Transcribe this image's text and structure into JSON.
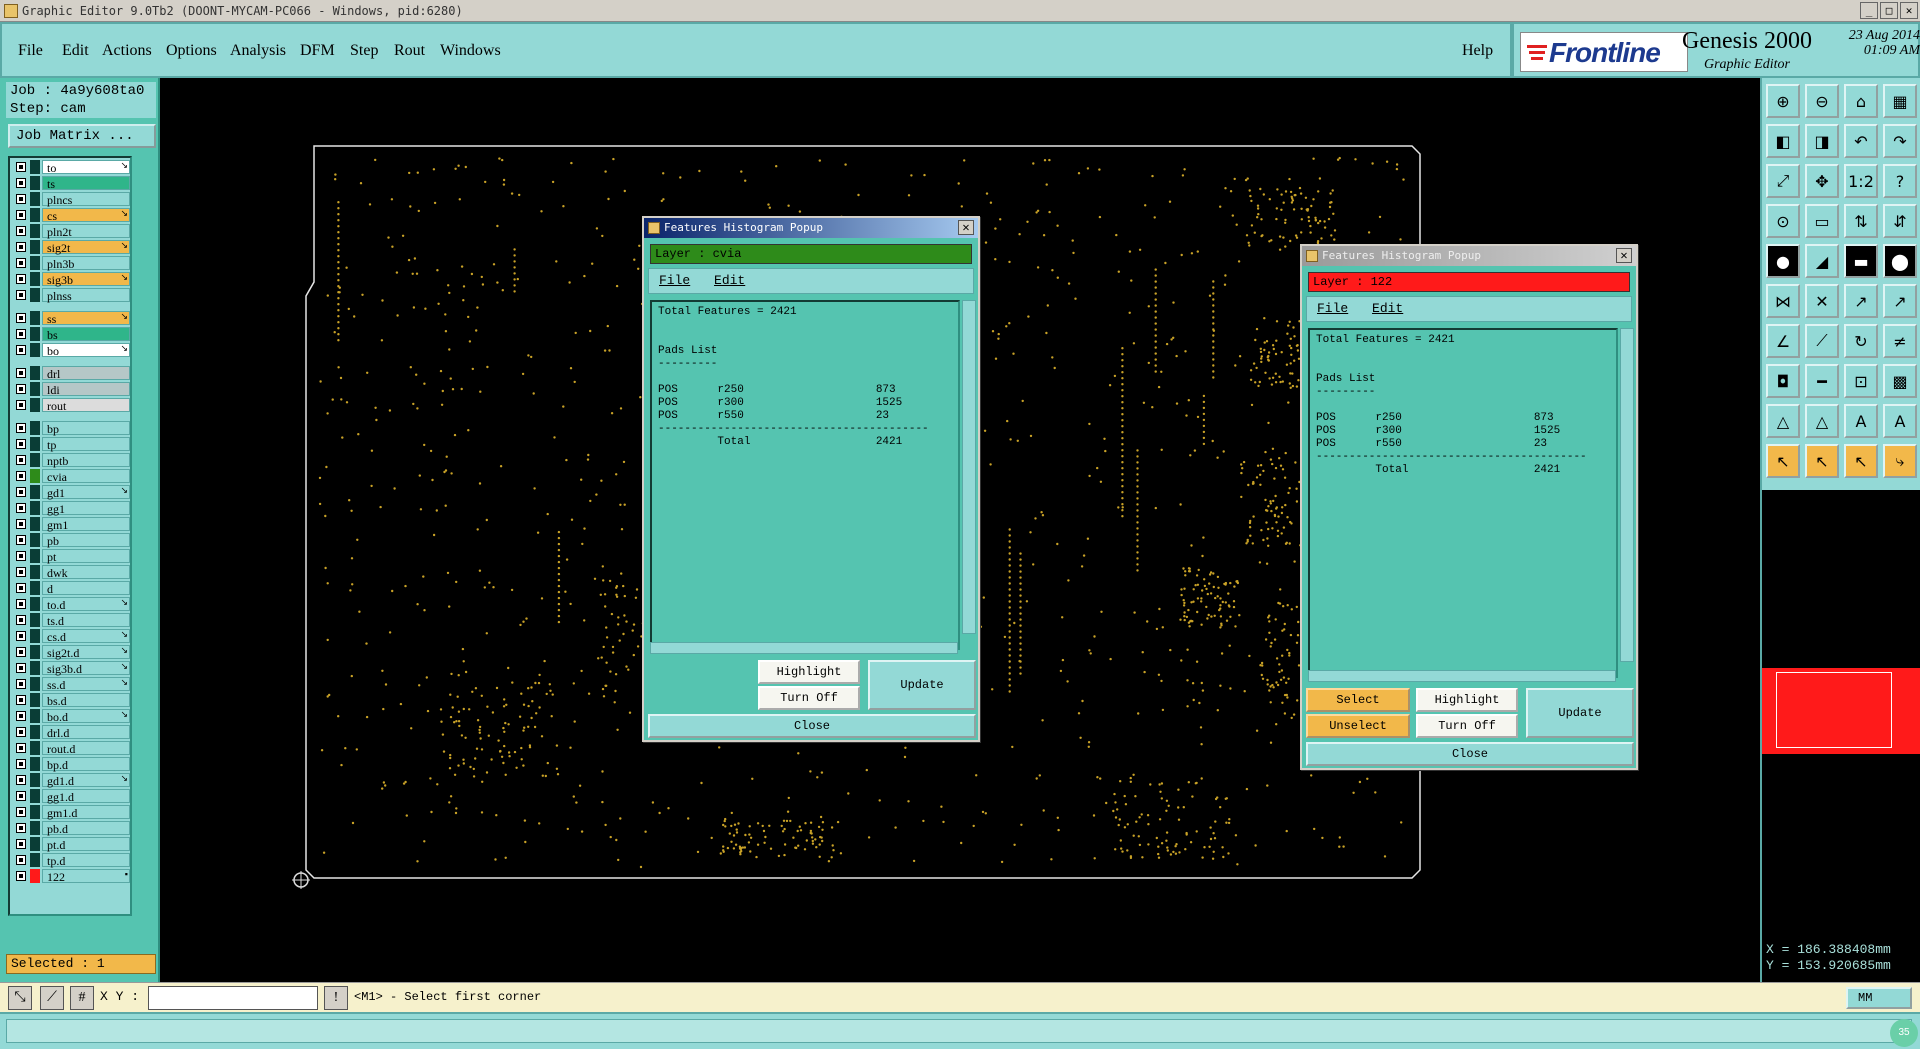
{
  "window": {
    "title": "Graphic Editor 9.0Tb2 (DOONT-MYCAM-PC066 - Windows, pid:6280)"
  },
  "menubar": {
    "items": [
      "File",
      "Edit",
      "Actions",
      "Options",
      "Analysis",
      "DFM",
      "Step",
      "Rout",
      "Windows"
    ],
    "help": "Help"
  },
  "branding": {
    "logo": "Frontline",
    "product": "Genesis 2000",
    "subtitle": "Graphic Editor",
    "date": "23 Aug 2014",
    "time": "01:09 AM"
  },
  "job": {
    "job_line": "Job : 4a9y608ta0",
    "step_line": "Step: cam",
    "matrix_button": "Job Matrix ..."
  },
  "layers": [
    {
      "name": "to",
      "color": "#ffffff",
      "mark": "↘"
    },
    {
      "name": "ts",
      "color": "#2fb58a",
      "mark": ""
    },
    {
      "name": "plncs",
      "color": "#93d9d6",
      "mark": ""
    },
    {
      "name": "cs",
      "color": "#f2b84a",
      "mark": "↘"
    },
    {
      "name": "pln2t",
      "color": "#93d9d6",
      "mark": ""
    },
    {
      "name": "sig2t",
      "color": "#f2b84a",
      "mark": "↘"
    },
    {
      "name": "pln3b",
      "color": "#93d9d6",
      "mark": ""
    },
    {
      "name": "sig3b",
      "color": "#f2b84a",
      "mark": "↘"
    },
    {
      "name": "plnss",
      "color": "#93d9d6",
      "mark": ""
    },
    {
      "name": "ss",
      "color": "#f2b84a",
      "mark": "↘"
    },
    {
      "name": "bs",
      "color": "#2fb58a",
      "mark": ""
    },
    {
      "name": "bo",
      "color": "#ffffff",
      "mark": "↘"
    },
    {
      "name": "drl",
      "color": "#b5c7c7",
      "mark": ""
    },
    {
      "name": "ldi",
      "color": "#b5c7c7",
      "mark": ""
    },
    {
      "name": "rout",
      "color": "#dcdcdc",
      "mark": ""
    },
    {
      "name": "bp",
      "color": "#93d9d6",
      "mark": ""
    },
    {
      "name": "tp",
      "color": "#93d9d6",
      "mark": ""
    },
    {
      "name": "nptb",
      "color": "#93d9d6",
      "mark": ""
    },
    {
      "name": "cvia",
      "color": "#93d9d6",
      "mark": ""
    },
    {
      "name": "gd1",
      "color": "#93d9d6",
      "mark": "↘"
    },
    {
      "name": "gg1",
      "color": "#93d9d6",
      "mark": ""
    },
    {
      "name": "gm1",
      "color": "#93d9d6",
      "mark": ""
    },
    {
      "name": "pb",
      "color": "#93d9d6",
      "mark": ""
    },
    {
      "name": "pt",
      "color": "#93d9d6",
      "mark": ""
    },
    {
      "name": "dwk",
      "color": "#93d9d6",
      "mark": ""
    },
    {
      "name": "d",
      "color": "#93d9d6",
      "mark": ""
    },
    {
      "name": "to.d",
      "color": "#93d9d6",
      "mark": "↘"
    },
    {
      "name": "ts.d",
      "color": "#93d9d6",
      "mark": ""
    },
    {
      "name": "cs.d",
      "color": "#93d9d6",
      "mark": "↘"
    },
    {
      "name": "sig2t.d",
      "color": "#93d9d6",
      "mark": "↘"
    },
    {
      "name": "sig3b.d",
      "color": "#93d9d6",
      "mark": "↘"
    },
    {
      "name": "ss.d",
      "color": "#93d9d6",
      "mark": "↘"
    },
    {
      "name": "bs.d",
      "color": "#93d9d6",
      "mark": ""
    },
    {
      "name": "bo.d",
      "color": "#93d9d6",
      "mark": "↘"
    },
    {
      "name": "drl.d",
      "color": "#93d9d6",
      "mark": ""
    },
    {
      "name": "rout.d",
      "color": "#93d9d6",
      "mark": ""
    },
    {
      "name": "bp.d",
      "color": "#93d9d6",
      "mark": ""
    },
    {
      "name": "gd1.d",
      "color": "#93d9d6",
      "mark": "↘"
    },
    {
      "name": "gg1.d",
      "color": "#93d9d6",
      "mark": ""
    },
    {
      "name": "gm1.d",
      "color": "#93d9d6",
      "mark": ""
    },
    {
      "name": "pb.d",
      "color": "#93d9d6",
      "mark": ""
    },
    {
      "name": "pt.d",
      "color": "#93d9d6",
      "mark": ""
    },
    {
      "name": "tp.d",
      "color": "#93d9d6",
      "mark": ""
    },
    {
      "name": "122",
      "color": "#93d9d6",
      "mark": "▪"
    }
  ],
  "selected": "Selected : 1",
  "popup1": {
    "title": "Features Histogram Popup",
    "layer": "Layer :  cvia",
    "layer_color": "#2e8b1a",
    "menu": [
      "File",
      "Edit"
    ],
    "text": "Total Features = 2421\n\n\nPads List\n---------\n\nPOS      r250                    873\nPOS      r300                    1525\nPOS      r550                    23\n-----------------------------------------\n         Total                   2421",
    "highlight": "Highlight",
    "turnoff": "Turn Off",
    "update": "Update",
    "close": "Close"
  },
  "popup2": {
    "title": "Features Histogram Popup",
    "layer": "Layer :  122",
    "layer_color": "#ff1a1a",
    "menu": [
      "File",
      "Edit"
    ],
    "text": "Total Features = 2421\n\n\nPads List\n---------\n\nPOS      r250                    873\nPOS      r300                    1525\nPOS      r550                    23\n-----------------------------------------\n         Total                   2421",
    "select": "Select",
    "unselect": "Unselect",
    "highlight": "Highlight",
    "turnoff": "Turn Off",
    "update": "Update",
    "close": "Close"
  },
  "coords": {
    "x": "X = 186.388408mm",
    "y": "Y = 153.920685mm"
  },
  "bottombar": {
    "xy_label": "X Y :",
    "xy_value": "",
    "message": "<M1> - Select first corner",
    "units": "MM",
    "badge": "35"
  },
  "toolbar_icons": [
    "zoom-in-icon",
    "zoom-out-icon",
    "home-icon",
    "grid-icon",
    "pan-left-icon",
    "pan-right-icon",
    "undo-icon",
    "redo-icon",
    "fit-icon",
    "center-icon",
    "ratio-icon",
    "help-icon",
    "measure-icon",
    "snap-icon",
    "layer-icon",
    "config-icon",
    "pad-icon",
    "line-icon",
    "dash-icon",
    "circle-icon",
    "node-icon",
    "cross-icon",
    "arrow-icon",
    "move-icon",
    "line-draw-icon",
    "slash-icon",
    "arc-icon",
    "flip-icon",
    "edit-icon",
    "minus-icon",
    "snap-grid-icon",
    "overlay-icon",
    "triangle-icon",
    "polygon-icon",
    "text-icon",
    "font-icon",
    "pointer-icon",
    "select-icon",
    "zoom-select-icon",
    "route-icon"
  ]
}
